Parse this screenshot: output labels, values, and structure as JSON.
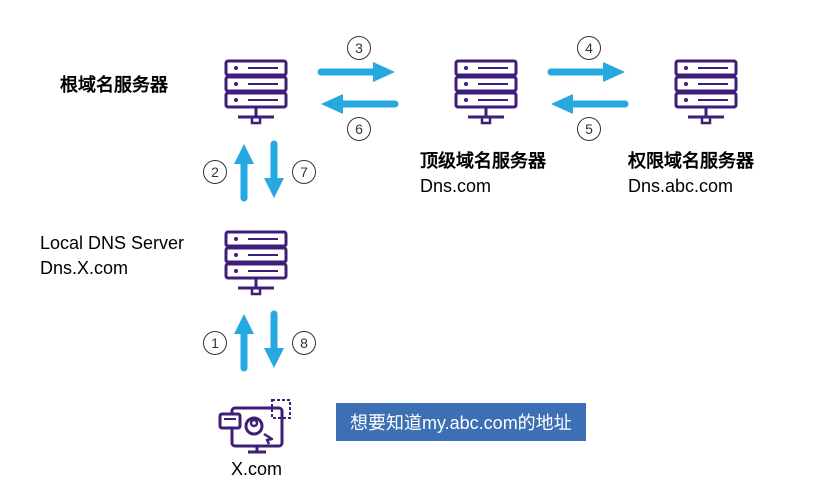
{
  "colors": {
    "line": "#3f1e7a",
    "arrow": "#26a8e0",
    "callout_bg": "#3c6fb4"
  },
  "nodes": {
    "root": {
      "label": "根域名服务器",
      "sub": ""
    },
    "tld": {
      "label": "顶级域名服务器",
      "sub": "Dns.com"
    },
    "auth": {
      "label": "权限域名服务器",
      "sub": "Dns.abc.com"
    },
    "local": {
      "label": "Local DNS Server",
      "sub": "Dns.X.com"
    },
    "client": {
      "label": "X.com"
    }
  },
  "steps": {
    "s1": "1",
    "s2": "2",
    "s3": "3",
    "s4": "4",
    "s5": "5",
    "s6": "6",
    "s7": "7",
    "s8": "8"
  },
  "callout": "想要知道my.abc.com的地址"
}
